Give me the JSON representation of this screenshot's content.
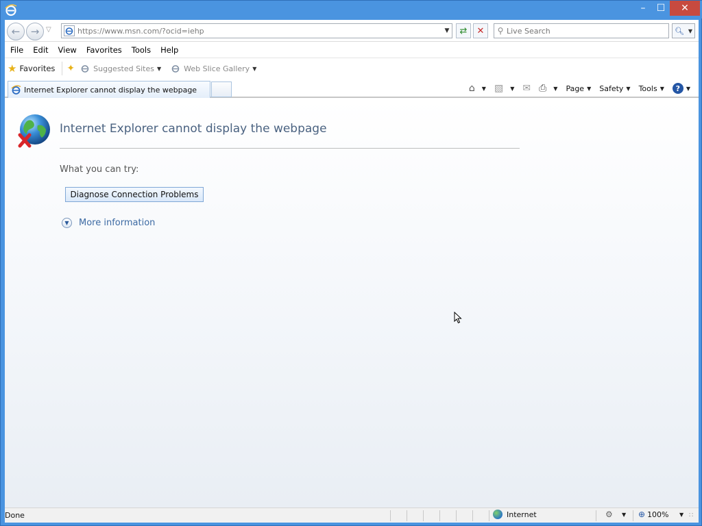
{
  "window": {
    "close_glyph": "✕",
    "maximize_glyph": "☐",
    "minimize_glyph": "–"
  },
  "address": {
    "url": "https://www.msn.com/?ocid=iehp",
    "search_placeholder": "Live Search"
  },
  "menu": [
    "File",
    "Edit",
    "View",
    "Favorites",
    "Tools",
    "Help"
  ],
  "favorites_bar": {
    "favorites_label": "Favorites",
    "links": [
      "Suggested Sites",
      "Web Slice Gallery"
    ]
  },
  "tab": {
    "title": "Internet Explorer cannot display the webpage"
  },
  "command_bar": {
    "page": "Page",
    "safety": "Safety",
    "tools": "Tools"
  },
  "error_page": {
    "title": "Internet Explorer cannot display the webpage",
    "try_label": "What you can try:",
    "diagnose_button": "Diagnose Connection Problems",
    "more_info": "More information"
  },
  "status": {
    "text": "Done",
    "zone": "Internet",
    "zoom": "100%"
  },
  "colors": {
    "titlebar": "#4a94e0",
    "close_button": "#c74a3f",
    "error_title": "#4a6280",
    "link": "#3c6aa3"
  }
}
